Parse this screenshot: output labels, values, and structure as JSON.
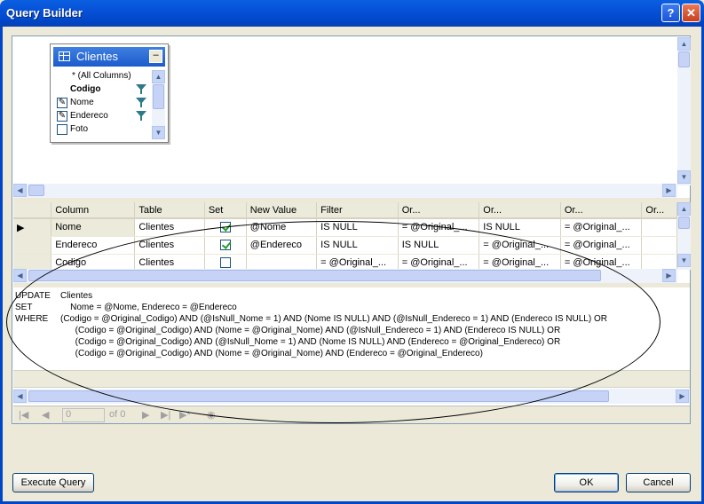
{
  "window": {
    "title": "Query Builder",
    "help_glyph": "?",
    "close_glyph": "✕"
  },
  "diagram": {
    "table_name": "Clientes",
    "minimize_glyph": "–",
    "columns": [
      {
        "label": "* (All Columns)",
        "bold": false,
        "checked": false,
        "filter": false,
        "edit_icon": false
      },
      {
        "label": "Codigo",
        "bold": true,
        "checked": false,
        "filter": true,
        "edit_icon": false
      },
      {
        "label": "Nome",
        "bold": false,
        "checked": true,
        "filter": true,
        "edit_icon": true
      },
      {
        "label": "Endereco",
        "bold": false,
        "checked": true,
        "filter": true,
        "edit_icon": true
      },
      {
        "label": "Foto",
        "bold": false,
        "checked": false,
        "filter": false,
        "edit_icon": false
      }
    ]
  },
  "grid": {
    "headers": [
      "Column",
      "Table",
      "Set",
      "New Value",
      "Filter",
      "Or...",
      "Or...",
      "Or...",
      "Or..."
    ],
    "rows": [
      {
        "column": "Nome",
        "table": "Clientes",
        "set": true,
        "new_value": "@Nome",
        "filter": "IS NULL",
        "or1": "= @Original_...",
        "or2": "IS NULL",
        "or3": "= @Original_..."
      },
      {
        "column": "Endereco",
        "table": "Clientes",
        "set": true,
        "new_value": "@Endereco",
        "filter": "IS NULL",
        "or1": "IS NULL",
        "or2": "= @Original_...",
        "or3": "= @Original_..."
      },
      {
        "column": "Codigo",
        "table": "Clientes",
        "set": false,
        "new_value": "",
        "filter": "= @Original_...",
        "or1": "= @Original_...",
        "or2": "= @Original_...",
        "or3": "= @Original_..."
      }
    ]
  },
  "sql": {
    "lines": [
      [
        "UPDATE",
        "Clientes"
      ],
      [
        "SET",
        "    Nome = @Nome, Endereco = @Endereco"
      ],
      [
        "WHERE",
        "(Codigo = @Original_Codigo) AND (@IsNull_Nome = 1) AND (Nome IS NULL) AND (@IsNull_Endereco = 1) AND (Endereco IS NULL) OR"
      ],
      [
        "",
        "      (Codigo = @Original_Codigo) AND (Nome = @Original_Nome) AND (@IsNull_Endereco = 1) AND (Endereco IS NULL) OR"
      ],
      [
        "",
        "      (Codigo = @Original_Codigo) AND (@IsNull_Nome = 1) AND (Nome IS NULL) AND (Endereco = @Original_Endereco) OR"
      ],
      [
        "",
        "      (Codigo = @Original_Codigo) AND (Nome = @Original_Nome) AND (Endereco = @Original_Endereco)"
      ]
    ]
  },
  "navigator": {
    "position": "0",
    "of_label": "of 0"
  },
  "buttons": {
    "execute": "Execute Query",
    "ok": "OK",
    "cancel": "Cancel"
  }
}
